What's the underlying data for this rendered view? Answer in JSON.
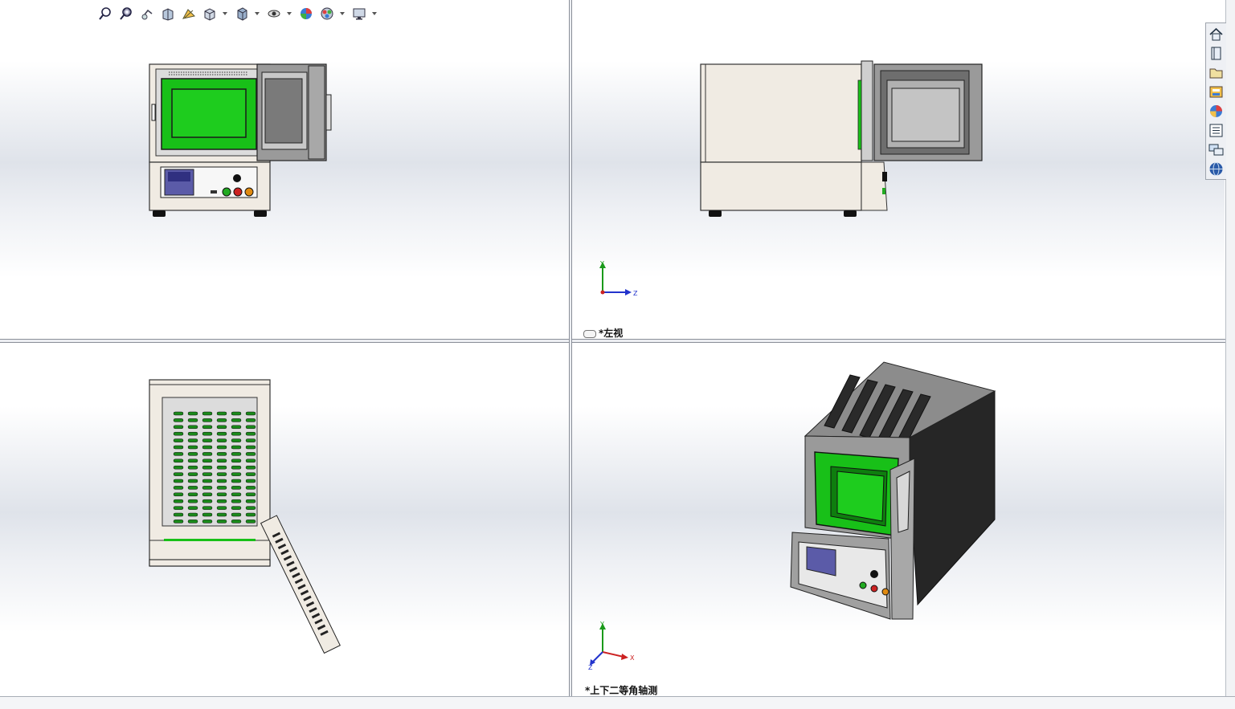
{
  "views": {
    "top_right_label": "*左视",
    "bottom_right_label": "*上下二等角轴测"
  },
  "triad": {
    "y": "Y",
    "z": "Z",
    "x": "X"
  },
  "toolbar_icons": [
    "zoom-to-fit-icon",
    "zoom-to-area-icon",
    "previous-view-icon",
    "section-view-icon",
    "dynamic-annotation-icon",
    "view-orientation-icon",
    "display-style-icon",
    "hide-show-items-icon",
    "edit-appearance-icon",
    "apply-scene-icon",
    "view-settings-icon"
  ],
  "taskpane_icons": [
    "home-icon",
    "resources-icon",
    "design-library-icon",
    "file-explorer-icon",
    "appearances-icon",
    "custom-properties-icon",
    "forum-icon",
    "web-icon"
  ],
  "colors": {
    "viewport_gradient_mid": "#dfe3ea",
    "oven_body": "#f0ebe3",
    "chamber_green": "#18c018",
    "door_gray": "#8a8a8a",
    "dark_side": "#2a2a2a"
  }
}
